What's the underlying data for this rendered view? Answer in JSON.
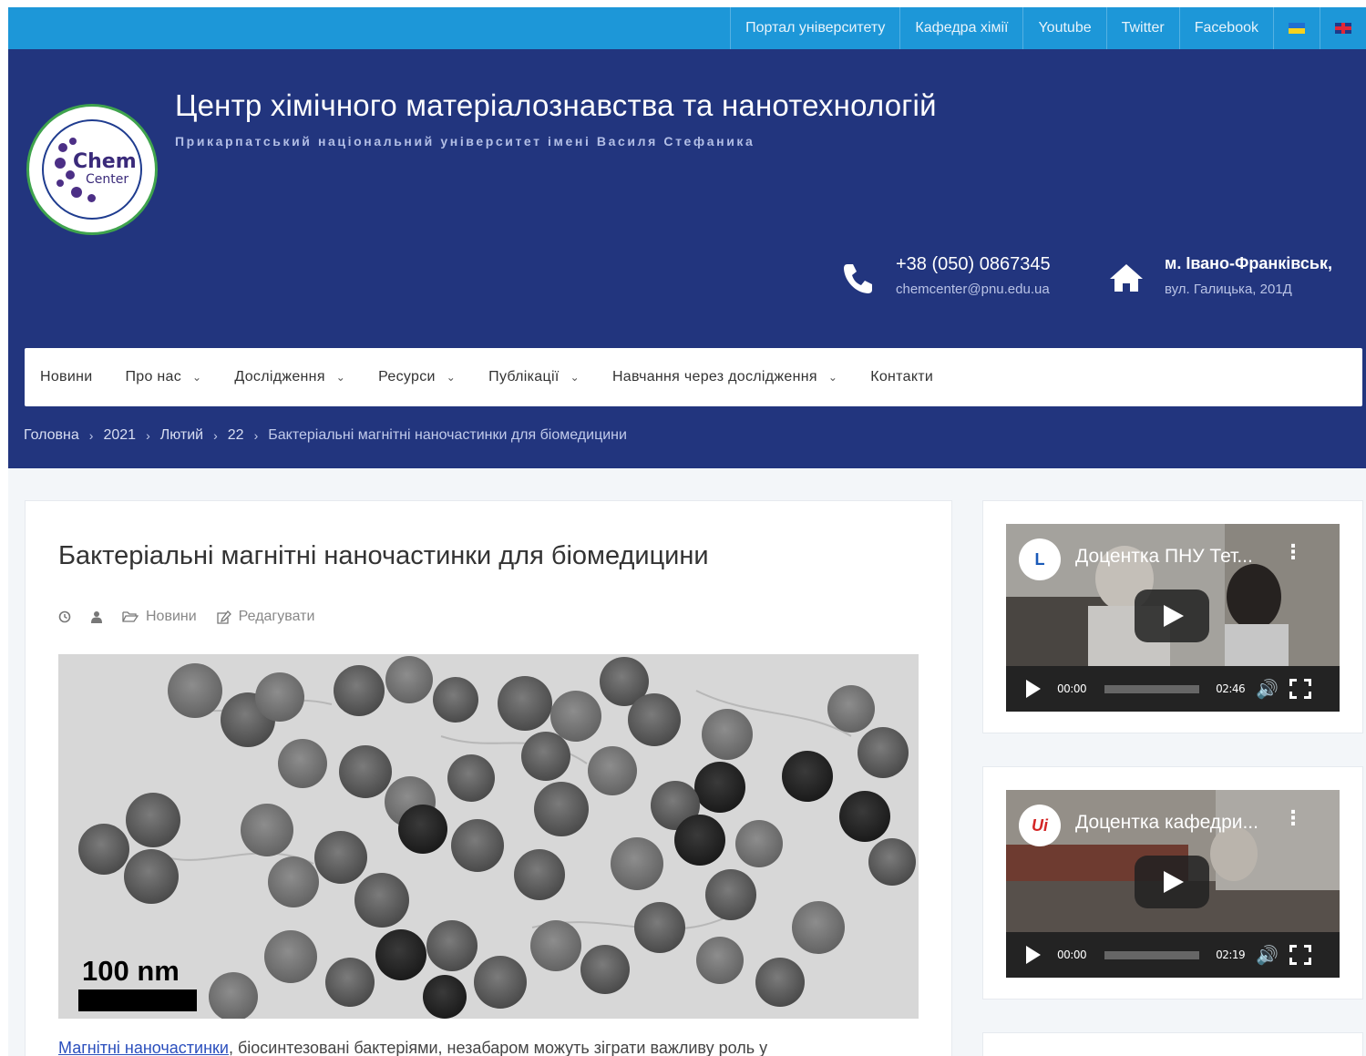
{
  "topbar": {
    "links": [
      "Портал університету",
      "Кафедра хімії",
      "Youtube",
      "Twitter",
      "Facebook"
    ],
    "flags": [
      "flag-ua-icon",
      "flag-uk-icon"
    ]
  },
  "header": {
    "logo": {
      "line1": "Chem",
      "line2": "Center"
    },
    "title": "Центр хімічного матеріалознавства та нанотехнологій",
    "subtitle": "Прикарпатський національний університет імені Василя Стефаника",
    "phone": "+38 (050) 0867345",
    "email": "chemcenter@pnu.edu.ua",
    "city": "м. Івано-Франківськ,",
    "street": "вул. Галицька, 201Д"
  },
  "nav": {
    "items": [
      {
        "label": "Новини"
      },
      {
        "label": "Про нас"
      },
      {
        "label": "Дослідження"
      },
      {
        "label": "Ресурси"
      },
      {
        "label": "Публікації"
      },
      {
        "label": "Навчання через дослідження"
      },
      {
        "label": "Контакти"
      }
    ]
  },
  "breadcrumb": [
    "Головна",
    "2021",
    "Лютий",
    "22",
    "Бактеріальні магнітні наночастинки для біомедицини"
  ],
  "article": {
    "title": "Бактеріальні магнітні наночастинки для біомедицини",
    "category": "Новини",
    "edit": "Редагувати",
    "scale_label": "100 nm",
    "text_link": "Магнітні наночастинки",
    "text_rest": ", біосинтезовані бактеріями, незабаром можуть зіграти важливу роль у"
  },
  "sidebar": {
    "videos": [
      {
        "title": "Доцентка ПНУ Тет...",
        "channel": "L",
        "current": "00:00",
        "duration": "02:46"
      },
      {
        "title": "Доцентка кафедри...",
        "channel": "Ui",
        "current": "00:00",
        "duration": "02:19"
      }
    ]
  },
  "colors": {
    "topbar": "#1d97d8",
    "header": "#22357e",
    "link": "#2b4fbd"
  }
}
